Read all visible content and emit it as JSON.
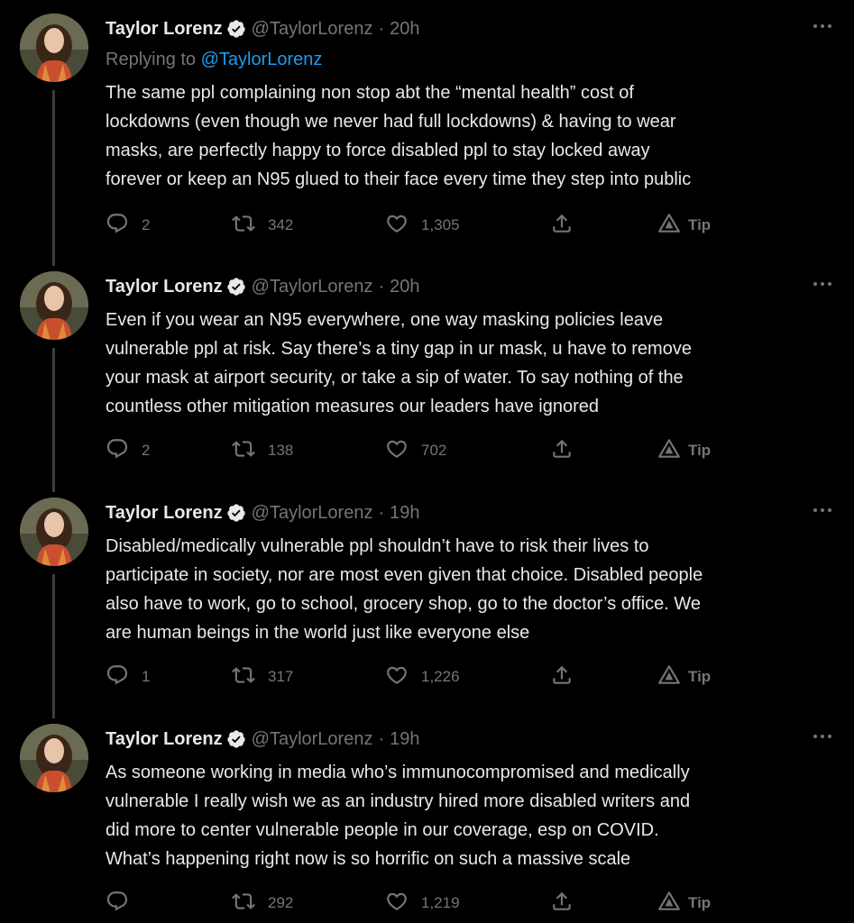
{
  "tweets": [
    {
      "name": "Taylor Lorenz",
      "handle": "@TaylorLorenz",
      "time": "20h",
      "replying_label": "Replying to",
      "replying_to": "@TaylorLorenz",
      "lines": [
        "The same ppl complaining non stop abt the “mental health” cost of",
        "lockdowns (even though we never had full lockdowns) & having to wear",
        "masks, are perfectly happy to force disabled ppl to stay locked away",
        "forever or keep an N95 glued to their face every time they step into public"
      ],
      "replies": "2",
      "retweets": "342",
      "likes": "1,305",
      "tip": "Tip"
    },
    {
      "name": "Taylor Lorenz",
      "handle": "@TaylorLorenz",
      "time": "20h",
      "lines": [
        "Even if you wear an N95 everywhere, one way masking policies leave",
        "vulnerable ppl at risk. Say there’s a tiny gap in ur mask, u have to remove",
        "your mask at airport security, or take a sip of water. To say nothing of the",
        "countless other mitigation measures our leaders have ignored"
      ],
      "replies": "2",
      "retweets": "138",
      "likes": "702",
      "tip": "Tip"
    },
    {
      "name": "Taylor Lorenz",
      "handle": "@TaylorLorenz",
      "time": "19h",
      "lines": [
        "Disabled/medically vulnerable ppl shouldn’t have to risk their lives to",
        "participate in society, nor are most even given that choice. Disabled people",
        "also have to work, go to school, grocery shop, go to the doctor’s office. We",
        "are human beings in the world just like everyone else"
      ],
      "replies": "1",
      "retweets": "317",
      "likes": "1,226",
      "tip": "Tip"
    },
    {
      "name": "Taylor Lorenz",
      "handle": "@TaylorLorenz",
      "time": "19h",
      "lines": [
        "As someone working in media who’s immunocompromised and medically",
        "vulnerable I really wish we as an industry hired more disabled writers and",
        "did more to center vulnerable people in our coverage, esp on COVID.",
        "What’s happening right now is so horrific on such a massive scale"
      ],
      "replies": "",
      "retweets": "292",
      "likes": "1,219",
      "tip": "Tip"
    }
  ],
  "colors": {
    "background": "#000000",
    "text": "#e7e9ea",
    "muted": "#71767b",
    "link": "#1d9bf0",
    "thread_line": "#3a3f44"
  },
  "icons": [
    "verified-badge-icon",
    "more-options-icon",
    "reply-icon",
    "retweet-icon",
    "like-icon",
    "share-icon",
    "tip-icon"
  ]
}
